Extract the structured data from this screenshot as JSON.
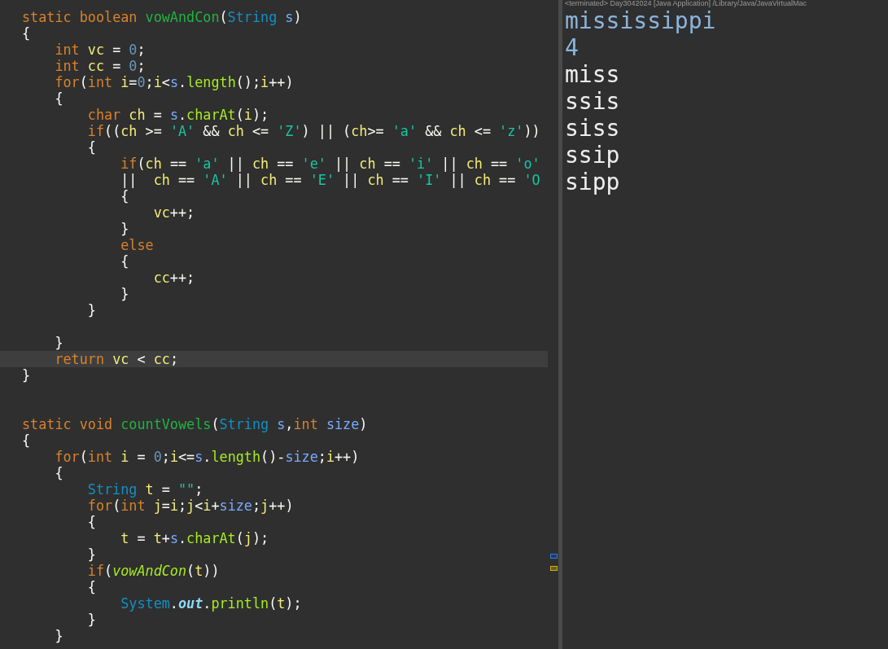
{
  "editor": {
    "lines": [
      {
        "tokens": [
          {
            "text": "static boolean ",
            "kind": "kw"
          },
          {
            "text": "vowAndCon",
            "kind": "decl"
          },
          {
            "text": "(",
            "kind": "plain"
          },
          {
            "text": "String ",
            "kind": "type"
          },
          {
            "text": "s",
            "kind": "param"
          },
          {
            "text": ")",
            "kind": "plain"
          }
        ]
      },
      {
        "tokens": [
          {
            "text": "{",
            "kind": "plain"
          }
        ],
        "children": [
          {
            "tokens": [
              {
                "text": "int ",
                "kind": "kw"
              },
              {
                "text": "vc",
                "kind": "local"
              },
              {
                "text": " = ",
                "kind": "plain"
              },
              {
                "text": "0",
                "kind": "num"
              },
              {
                "text": ";",
                "kind": "plain"
              }
            ]
          },
          {
            "tokens": [
              {
                "text": "int ",
                "kind": "kw"
              },
              {
                "text": "cc",
                "kind": "local"
              },
              {
                "text": " = ",
                "kind": "plain"
              },
              {
                "text": "0",
                "kind": "num"
              },
              {
                "text": ";",
                "kind": "plain"
              }
            ]
          },
          {
            "tokens": [
              {
                "text": "for",
                "kind": "kw"
              },
              {
                "text": "(",
                "kind": "plain"
              },
              {
                "text": "int ",
                "kind": "kw"
              },
              {
                "text": "i",
                "kind": "local"
              },
              {
                "text": "=",
                "kind": "plain"
              },
              {
                "text": "0",
                "kind": "num"
              },
              {
                "text": ";",
                "kind": "plain"
              },
              {
                "text": "i",
                "kind": "local"
              },
              {
                "text": "<",
                "kind": "plain"
              },
              {
                "text": "s",
                "kind": "param"
              },
              {
                "text": ".",
                "kind": "plain"
              },
              {
                "text": "length",
                "kind": "call"
              },
              {
                "text": "();",
                "kind": "plain"
              },
              {
                "text": "i",
                "kind": "local"
              },
              {
                "text": "++)",
                "kind": "plain"
              }
            ]
          },
          {
            "tokens": [
              {
                "text": "{",
                "kind": "plain"
              }
            ],
            "children": [
              {
                "tokens": [
                  {
                    "text": "char ",
                    "kind": "kw"
                  },
                  {
                    "text": "ch",
                    "kind": "local"
                  },
                  {
                    "text": " = ",
                    "kind": "plain"
                  },
                  {
                    "text": "s",
                    "kind": "param"
                  },
                  {
                    "text": ".",
                    "kind": "plain"
                  },
                  {
                    "text": "charAt",
                    "kind": "call"
                  },
                  {
                    "text": "(",
                    "kind": "plain"
                  },
                  {
                    "text": "i",
                    "kind": "local"
                  },
                  {
                    "text": ");",
                    "kind": "plain"
                  }
                ]
              },
              {
                "tokens": [
                  {
                    "text": "if",
                    "kind": "kw"
                  },
                  {
                    "text": "((",
                    "kind": "plain"
                  },
                  {
                    "text": "ch",
                    "kind": "local"
                  },
                  {
                    "text": " >= ",
                    "kind": "plain"
                  },
                  {
                    "text": "'A'",
                    "kind": "str"
                  },
                  {
                    "text": " && ",
                    "kind": "plain"
                  },
                  {
                    "text": "ch",
                    "kind": "local"
                  },
                  {
                    "text": " <= ",
                    "kind": "plain"
                  },
                  {
                    "text": "'Z'",
                    "kind": "str"
                  },
                  {
                    "text": ") || (",
                    "kind": "plain"
                  },
                  {
                    "text": "ch",
                    "kind": "local"
                  },
                  {
                    "text": ">= ",
                    "kind": "plain"
                  },
                  {
                    "text": "'a'",
                    "kind": "str"
                  },
                  {
                    "text": " && ",
                    "kind": "plain"
                  },
                  {
                    "text": "ch",
                    "kind": "local"
                  },
                  {
                    "text": " <= ",
                    "kind": "plain"
                  },
                  {
                    "text": "'z'",
                    "kind": "str"
                  },
                  {
                    "text": "))",
                    "kind": "plain"
                  }
                ]
              },
              {
                "tokens": [
                  {
                    "text": "{",
                    "kind": "plain"
                  }
                ],
                "children": [
                  {
                    "tokens": [
                      {
                        "text": "if",
                        "kind": "kw"
                      },
                      {
                        "text": "(",
                        "kind": "plain"
                      },
                      {
                        "text": "ch",
                        "kind": "local"
                      },
                      {
                        "text": " == ",
                        "kind": "plain"
                      },
                      {
                        "text": "'a'",
                        "kind": "str"
                      },
                      {
                        "text": " || ",
                        "kind": "plain"
                      },
                      {
                        "text": "ch",
                        "kind": "local"
                      },
                      {
                        "text": " == ",
                        "kind": "plain"
                      },
                      {
                        "text": "'e'",
                        "kind": "str"
                      },
                      {
                        "text": " || ",
                        "kind": "plain"
                      },
                      {
                        "text": "ch",
                        "kind": "local"
                      },
                      {
                        "text": " == ",
                        "kind": "plain"
                      },
                      {
                        "text": "'i'",
                        "kind": "str"
                      },
                      {
                        "text": " || ",
                        "kind": "plain"
                      },
                      {
                        "text": "ch",
                        "kind": "local"
                      },
                      {
                        "text": " == ",
                        "kind": "plain"
                      },
                      {
                        "text": "'o'",
                        "kind": "str"
                      }
                    ]
                  },
                  {
                    "tokens": [
                      {
                        "text": "||  ",
                        "kind": "plain"
                      },
                      {
                        "text": "ch",
                        "kind": "local"
                      },
                      {
                        "text": " == ",
                        "kind": "plain"
                      },
                      {
                        "text": "'A'",
                        "kind": "str"
                      },
                      {
                        "text": " || ",
                        "kind": "plain"
                      },
                      {
                        "text": "ch",
                        "kind": "local"
                      },
                      {
                        "text": " == ",
                        "kind": "plain"
                      },
                      {
                        "text": "'E'",
                        "kind": "str"
                      },
                      {
                        "text": " || ",
                        "kind": "plain"
                      },
                      {
                        "text": "ch",
                        "kind": "local"
                      },
                      {
                        "text": " == ",
                        "kind": "plain"
                      },
                      {
                        "text": "'I'",
                        "kind": "str"
                      },
                      {
                        "text": " || ",
                        "kind": "plain"
                      },
                      {
                        "text": "ch",
                        "kind": "local"
                      },
                      {
                        "text": " == ",
                        "kind": "plain"
                      },
                      {
                        "text": "'O",
                        "kind": "str"
                      }
                    ]
                  },
                  {
                    "tokens": [
                      {
                        "text": "{",
                        "kind": "plain"
                      }
                    ],
                    "children": [
                      {
                        "tokens": [
                          {
                            "text": "vc",
                            "kind": "local"
                          },
                          {
                            "text": "++;",
                            "kind": "plain"
                          }
                        ]
                      }
                    ]
                  },
                  {
                    "tokens": [
                      {
                        "text": "}",
                        "kind": "plain"
                      }
                    ]
                  },
                  {
                    "tokens": [
                      {
                        "text": "else",
                        "kind": "kw"
                      }
                    ]
                  },
                  {
                    "tokens": [
                      {
                        "text": "{",
                        "kind": "plain"
                      }
                    ],
                    "children": [
                      {
                        "tokens": [
                          {
                            "text": "cc",
                            "kind": "local"
                          },
                          {
                            "text": "++;",
                            "kind": "plain"
                          }
                        ]
                      }
                    ]
                  },
                  {
                    "tokens": [
                      {
                        "text": "}",
                        "kind": "plain"
                      }
                    ]
                  }
                ]
              },
              {
                "tokens": [
                  {
                    "text": "}",
                    "kind": "plain"
                  }
                ]
              }
            ]
          },
          {
            "kind": "blank"
          },
          {
            "tokens": [
              {
                "text": "}",
                "kind": "plain"
              }
            ]
          },
          {
            "current": true,
            "tokens": [
              {
                "text": "return ",
                "kind": "kw"
              },
              {
                "text": "vc",
                "kind": "local"
              },
              {
                "text": " < ",
                "kind": "plain"
              },
              {
                "text": "cc",
                "kind": "local"
              },
              {
                "text": ";",
                "kind": "plain"
              }
            ]
          }
        ]
      },
      {
        "tokens": [
          {
            "text": "}",
            "kind": "plain"
          }
        ]
      },
      {
        "kind": "blank"
      },
      {
        "kind": "blank"
      },
      {
        "tokens": [
          {
            "text": "static void ",
            "kind": "kw"
          },
          {
            "text": "countVowels",
            "kind": "decl"
          },
          {
            "text": "(",
            "kind": "plain"
          },
          {
            "text": "String ",
            "kind": "type"
          },
          {
            "text": "s",
            "kind": "param"
          },
          {
            "text": ",",
            "kind": "plain"
          },
          {
            "text": "int ",
            "kind": "kw"
          },
          {
            "text": "size",
            "kind": "param"
          },
          {
            "text": ")",
            "kind": "plain"
          }
        ]
      },
      {
        "tokens": [
          {
            "text": "{",
            "kind": "plain"
          }
        ],
        "children": [
          {
            "tokens": [
              {
                "text": "for",
                "kind": "kw"
              },
              {
                "text": "(",
                "kind": "plain"
              },
              {
                "text": "int ",
                "kind": "kw"
              },
              {
                "text": "i",
                "kind": "local"
              },
              {
                "text": " = ",
                "kind": "plain"
              },
              {
                "text": "0",
                "kind": "num"
              },
              {
                "text": ";",
                "kind": "plain"
              },
              {
                "text": "i",
                "kind": "local"
              },
              {
                "text": "<=",
                "kind": "plain"
              },
              {
                "text": "s",
                "kind": "param"
              },
              {
                "text": ".",
                "kind": "plain"
              },
              {
                "text": "length",
                "kind": "call"
              },
              {
                "text": "()-",
                "kind": "plain"
              },
              {
                "text": "size",
                "kind": "param"
              },
              {
                "text": ";",
                "kind": "plain"
              },
              {
                "text": "i",
                "kind": "local"
              },
              {
                "text": "++)",
                "kind": "plain"
              }
            ]
          },
          {
            "tokens": [
              {
                "text": "{",
                "kind": "plain"
              }
            ],
            "children": [
              {
                "tokens": [
                  {
                    "text": "String ",
                    "kind": "type"
                  },
                  {
                    "text": "t",
                    "kind": "local"
                  },
                  {
                    "text": " = ",
                    "kind": "plain"
                  },
                  {
                    "text": "\"\"",
                    "kind": "str"
                  },
                  {
                    "text": ";",
                    "kind": "plain"
                  }
                ]
              },
              {
                "tokens": [
                  {
                    "text": "for",
                    "kind": "kw"
                  },
                  {
                    "text": "(",
                    "kind": "plain"
                  },
                  {
                    "text": "int ",
                    "kind": "kw"
                  },
                  {
                    "text": "j",
                    "kind": "local"
                  },
                  {
                    "text": "=",
                    "kind": "plain"
                  },
                  {
                    "text": "i",
                    "kind": "local"
                  },
                  {
                    "text": ";",
                    "kind": "plain"
                  },
                  {
                    "text": "j",
                    "kind": "local"
                  },
                  {
                    "text": "<",
                    "kind": "plain"
                  },
                  {
                    "text": "i",
                    "kind": "local"
                  },
                  {
                    "text": "+",
                    "kind": "plain"
                  },
                  {
                    "text": "size",
                    "kind": "param"
                  },
                  {
                    "text": ";",
                    "kind": "plain"
                  },
                  {
                    "text": "j",
                    "kind": "local"
                  },
                  {
                    "text": "++)",
                    "kind": "plain"
                  }
                ]
              },
              {
                "tokens": [
                  {
                    "text": "{",
                    "kind": "plain"
                  }
                ],
                "children": [
                  {
                    "tokens": [
                      {
                        "text": "t",
                        "kind": "local"
                      },
                      {
                        "text": " = ",
                        "kind": "plain"
                      },
                      {
                        "text": "t",
                        "kind": "local"
                      },
                      {
                        "text": "+",
                        "kind": "plain"
                      },
                      {
                        "text": "s",
                        "kind": "param"
                      },
                      {
                        "text": ".",
                        "kind": "plain"
                      },
                      {
                        "text": "charAt",
                        "kind": "call"
                      },
                      {
                        "text": "(",
                        "kind": "plain"
                      },
                      {
                        "text": "j",
                        "kind": "local"
                      },
                      {
                        "text": ");",
                        "kind": "plain"
                      }
                    ]
                  }
                ]
              },
              {
                "tokens": [
                  {
                    "text": "}",
                    "kind": "plain"
                  }
                ]
              },
              {
                "tokens": [
                  {
                    "text": "if",
                    "kind": "kw"
                  },
                  {
                    "text": "(",
                    "kind": "plain"
                  },
                  {
                    "text": "vowAndCon",
                    "kind": "static"
                  },
                  {
                    "text": "(",
                    "kind": "plain"
                  },
                  {
                    "text": "t",
                    "kind": "local"
                  },
                  {
                    "text": "))",
                    "kind": "plain"
                  }
                ]
              },
              {
                "tokens": [
                  {
                    "text": "{",
                    "kind": "plain"
                  }
                ],
                "children": [
                  {
                    "tokens": [
                      {
                        "text": "System",
                        "kind": "type"
                      },
                      {
                        "text": ".",
                        "kind": "plain"
                      },
                      {
                        "text": "out",
                        "kind": "field"
                      },
                      {
                        "text": ".",
                        "kind": "plain"
                      },
                      {
                        "text": "println",
                        "kind": "call"
                      },
                      {
                        "text": "(",
                        "kind": "plain"
                      },
                      {
                        "text": "t",
                        "kind": "local"
                      },
                      {
                        "text": ");",
                        "kind": "plain"
                      }
                    ]
                  }
                ]
              },
              {
                "tokens": [
                  {
                    "text": "}",
                    "kind": "plain"
                  }
                ]
              }
            ]
          },
          {
            "tokens": [
              {
                "text": "}",
                "kind": "plain"
              }
            ]
          }
        ]
      }
    ]
  },
  "console": {
    "header": "<terminated> Day3042024 [Java Application] /Library/Java/JavaVirtualMac",
    "lines": [
      {
        "text": "mississippi",
        "kind": "input"
      },
      {
        "text": "4",
        "kind": "input"
      },
      {
        "text": "miss",
        "kind": "output"
      },
      {
        "text": "ssis",
        "kind": "output"
      },
      {
        "text": "siss",
        "kind": "output"
      },
      {
        "text": "ssip",
        "kind": "output"
      },
      {
        "text": "sipp",
        "kind": "output"
      }
    ]
  }
}
